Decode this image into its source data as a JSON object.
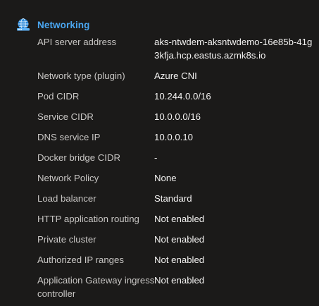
{
  "section": {
    "title": "Networking",
    "icon": "networking-globe-icon"
  },
  "properties": [
    {
      "label": "API server address",
      "value": "aks-ntwdem-aksntwdemo-16e85b-41g3kfja.hcp.eastus.azmk8s.io"
    },
    {
      "label": "Network type (plugin)",
      "value": "Azure CNI"
    },
    {
      "label": "Pod CIDR",
      "value": "10.244.0.0/16"
    },
    {
      "label": "Service CIDR",
      "value": "10.0.0.0/16"
    },
    {
      "label": "DNS service IP",
      "value": "10.0.0.10"
    },
    {
      "label": "Docker bridge CIDR",
      "value": "-"
    },
    {
      "label": "Network Policy",
      "value": "None"
    },
    {
      "label": "Load balancer",
      "value": "Standard"
    },
    {
      "label": "HTTP application routing",
      "value": "Not enabled"
    },
    {
      "label": "Private cluster",
      "value": "Not enabled"
    },
    {
      "label": "Authorized IP ranges",
      "value": "Not enabled"
    },
    {
      "label": "Application Gateway ingress controller",
      "value": "Not enabled"
    }
  ]
}
